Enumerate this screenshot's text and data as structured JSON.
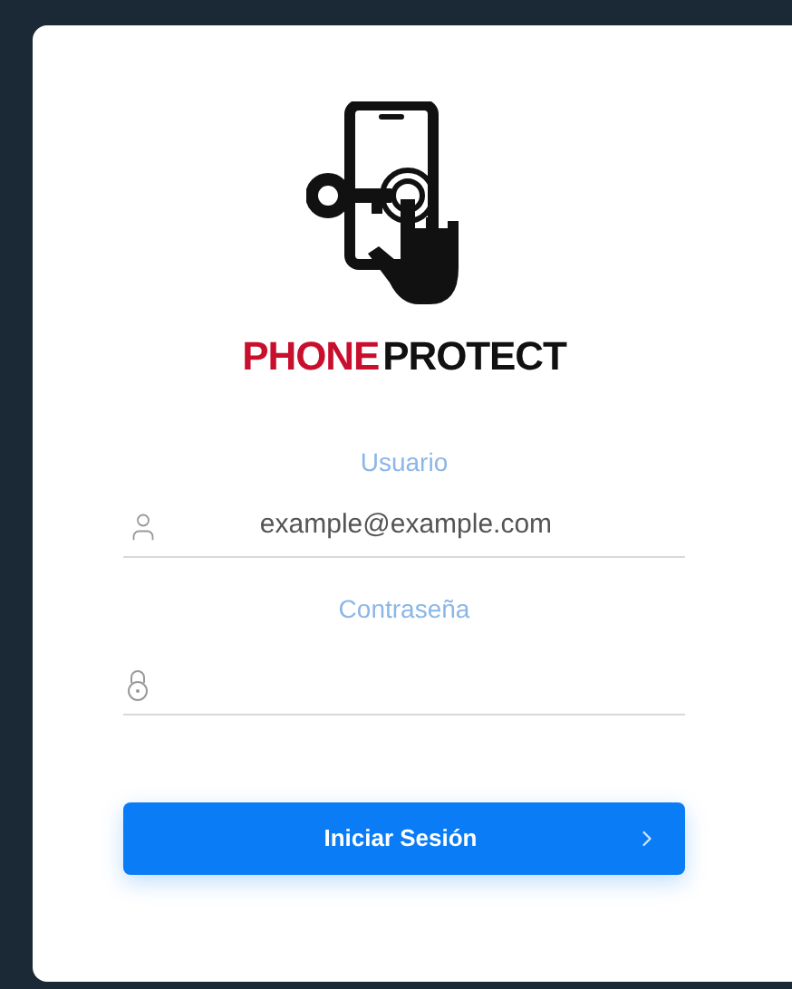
{
  "logo": {
    "word_1": "PHONE",
    "word_2": "PROTECT"
  },
  "username": {
    "label": "Usuario",
    "value": "example@example.com"
  },
  "password": {
    "label": "Contraseña"
  },
  "login_button": {
    "label": "Iniciar Sesión"
  }
}
